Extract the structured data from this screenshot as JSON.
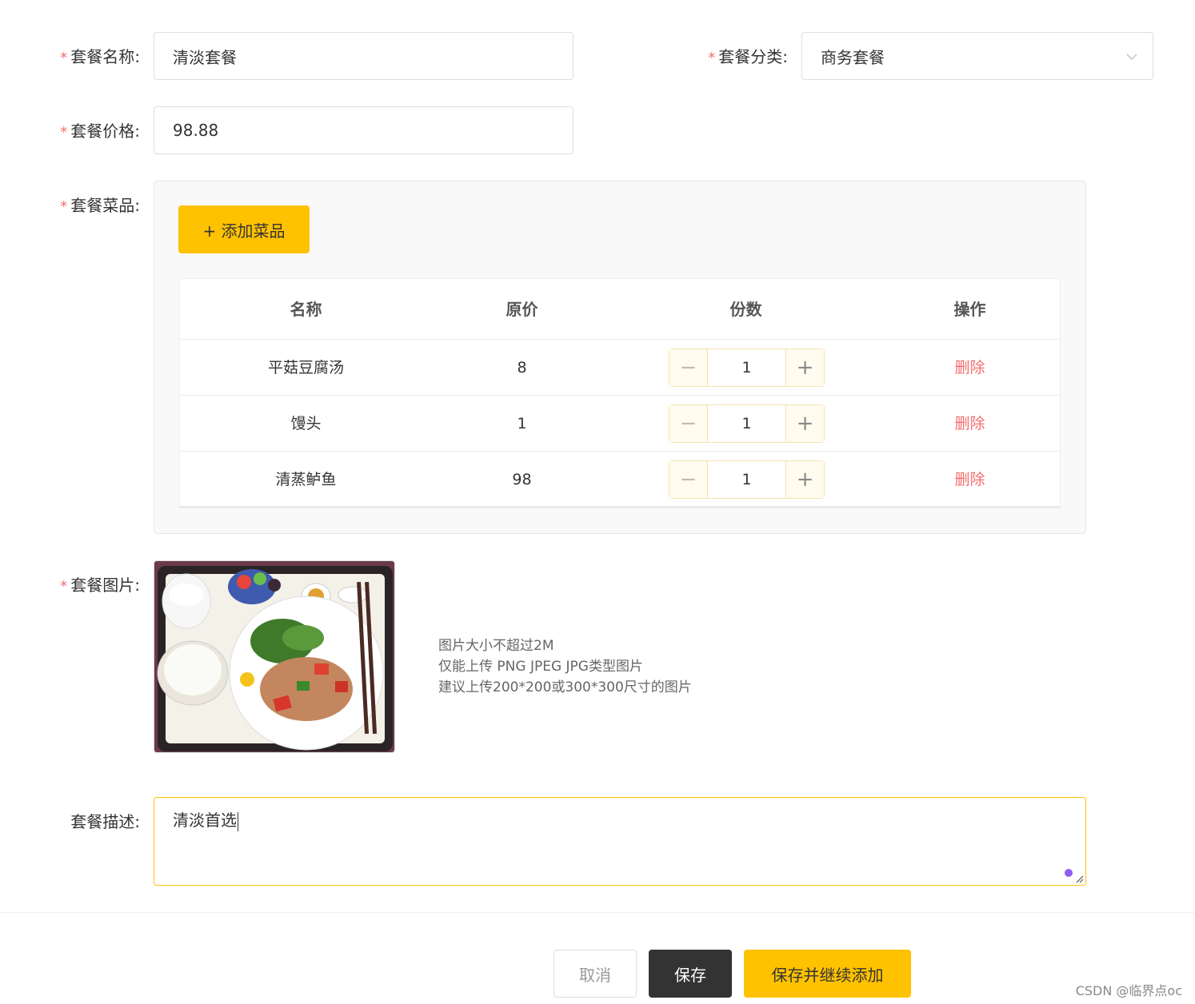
{
  "form": {
    "name": {
      "label": "套餐名称:",
      "value": "清淡套餐"
    },
    "category": {
      "label": "套餐分类:",
      "value": "商务套餐"
    },
    "price": {
      "label": "套餐价格:",
      "value": "98.88"
    },
    "dishes": {
      "label": "套餐菜品:",
      "add_button": "+ 添加菜品",
      "columns": [
        "名称",
        "原价",
        "份数",
        "操作"
      ],
      "rows": [
        {
          "name": "平菇豆腐汤",
          "price": "8",
          "qty": "1",
          "action": "删除"
        },
        {
          "name": "馒头",
          "price": "1",
          "qty": "1",
          "action": "删除"
        },
        {
          "name": "清蒸鲈鱼",
          "price": "98",
          "qty": "1",
          "action": "删除"
        }
      ],
      "minus": "−",
      "plus": "+"
    },
    "image": {
      "label": "套餐图片:",
      "hints": [
        "图片大小不超过2M",
        "仅能上传 PNG JPEG JPG类型图片",
        "建议上传200*200或300*300尺寸的图片"
      ]
    },
    "description": {
      "label": "套餐描述:",
      "value": "清淡首选"
    },
    "required_mark": "*"
  },
  "footer": {
    "cancel": "取消",
    "save": "保存",
    "save_and_add": "保存并继续添加"
  },
  "watermark": "CSDN @临界点oc",
  "colors": {
    "accent": "#ffc200",
    "danger": "#f56c6c",
    "dark": "#333333"
  }
}
